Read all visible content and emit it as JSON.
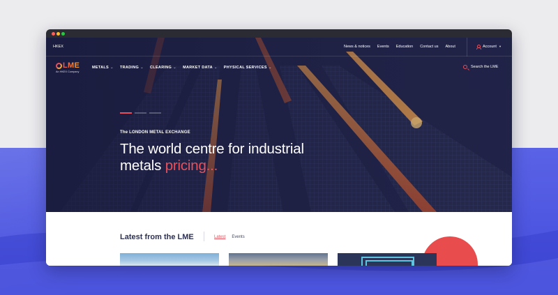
{
  "topbar": {
    "hkex": "HKEX",
    "links": [
      "News & notices",
      "Events",
      "Education",
      "Contact us",
      "About"
    ],
    "account_label": "Account"
  },
  "navbar": {
    "logo_text": "LME",
    "logo_sub": "An HKEX Company",
    "items": [
      "METALS",
      "TRADING",
      "CLEARING",
      "MARKET DATA",
      "PHYSICAL SERVICES"
    ],
    "search_label": "Search the LME"
  },
  "hero": {
    "eyebrow": "The LONDON METAL EXCHANGE",
    "headline_line1": "The world centre for industrial",
    "headline_line2_plain": "metals",
    "headline_line2_accent": "pricing..."
  },
  "latest": {
    "title": "Latest from the LME",
    "tabs": [
      "Latest",
      "Events"
    ]
  },
  "colors": {
    "accent": "#e8505b",
    "nav_bg": "#1f2244",
    "heading": "#2d3152",
    "backdrop_band": "#4c55e0"
  },
  "icons": [
    "user-icon",
    "chevron-down-icon",
    "search-icon"
  ]
}
